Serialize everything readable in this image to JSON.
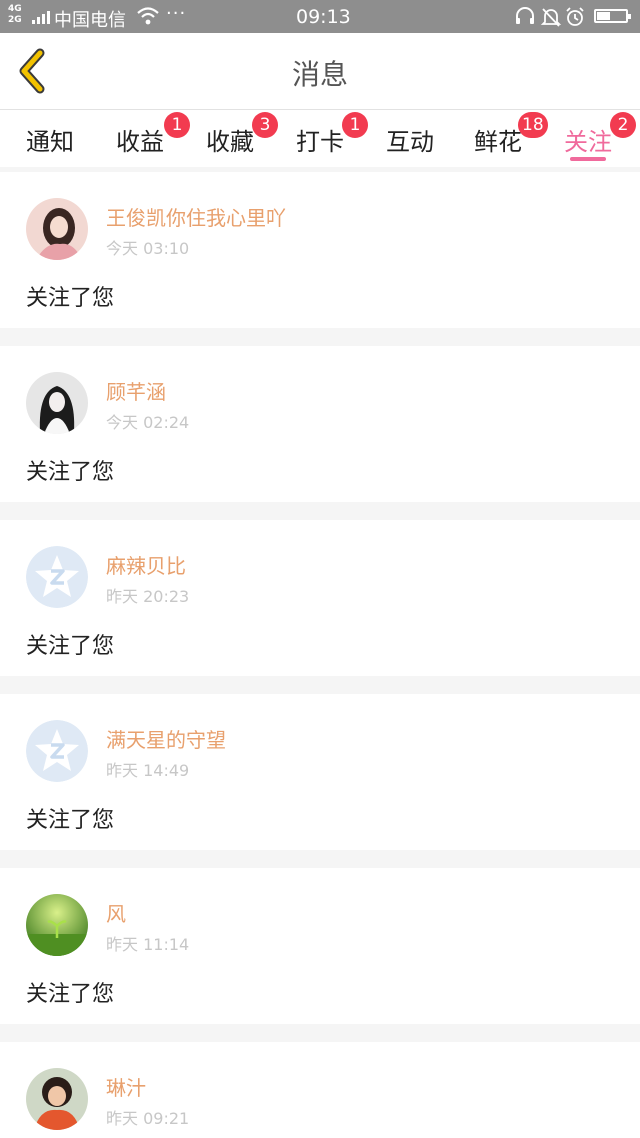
{
  "status_bar": {
    "network": [
      "4G",
      "2G"
    ],
    "carrier": "中国电信",
    "dots": "···",
    "time": "09:13",
    "battery_level": 0.45
  },
  "header": {
    "title": "消息"
  },
  "tabs": [
    {
      "label": "通知",
      "badge": ""
    },
    {
      "label": "收益",
      "badge": "1"
    },
    {
      "label": "收藏",
      "badge": "3"
    },
    {
      "label": "打卡",
      "badge": "1"
    },
    {
      "label": "互动",
      "badge": ""
    },
    {
      "label": "鲜花",
      "badge": "18"
    },
    {
      "label": "关注",
      "badge": "2",
      "active": true
    }
  ],
  "colors": {
    "accent": "#f06a9c",
    "badge": "#f23b50",
    "name": "#e8a06d",
    "back": "#f2c200"
  },
  "feed": [
    {
      "name": "王俊凯你住我心里吖",
      "time": "今天 03:10",
      "action": "关注了您",
      "avatar": "photo-avatar-girl"
    },
    {
      "name": "顾芊涵",
      "time": "今天 02:24",
      "action": "关注了您",
      "avatar": "photo-avatar-singer"
    },
    {
      "name": "麻辣贝比",
      "time": "昨天 20:23",
      "action": "关注了您",
      "avatar": "default-star-avatar"
    },
    {
      "name": "满天星的守望",
      "time": "昨天 14:49",
      "action": "关注了您",
      "avatar": "default-star-avatar"
    },
    {
      "name": "风",
      "time": "昨天 11:14",
      "action": "关注了您",
      "avatar": "photo-avatar-grass"
    },
    {
      "name": "琳汁",
      "time": "昨天 09:21",
      "action": "",
      "avatar": "photo-avatar-boy"
    }
  ]
}
